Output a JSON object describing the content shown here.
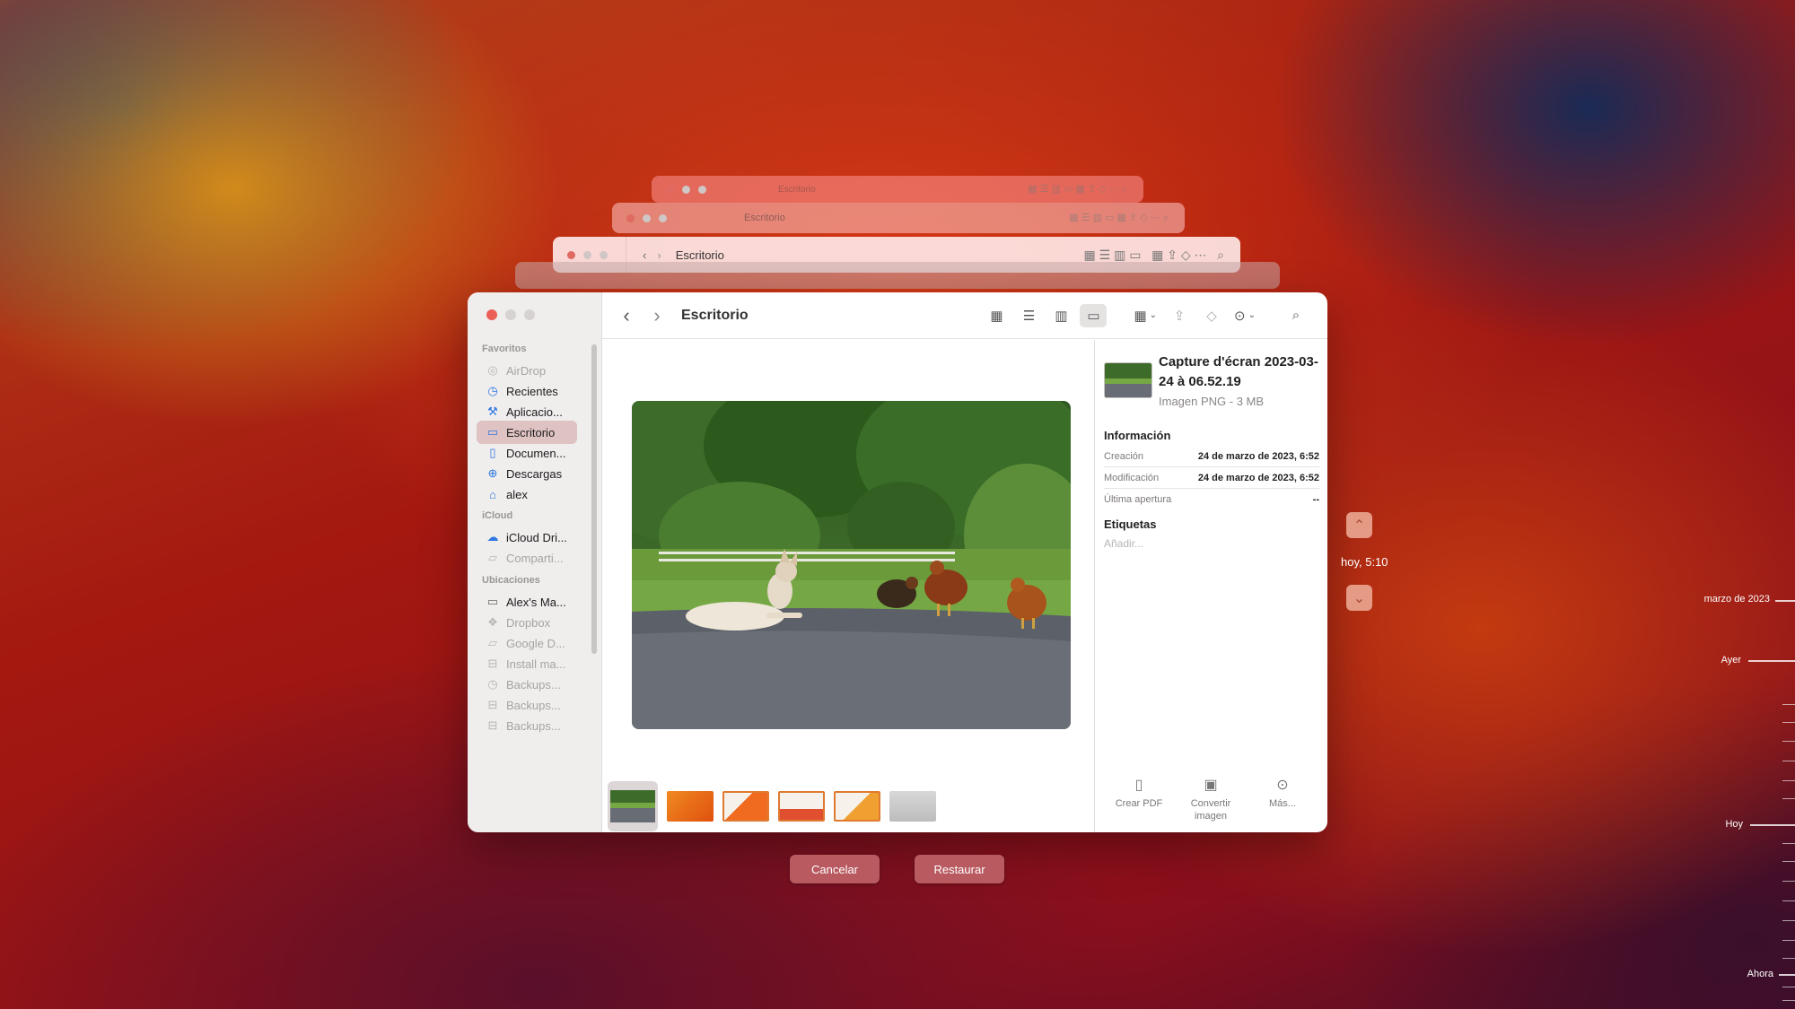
{
  "window": {
    "title": "Escritorio"
  },
  "ghost_windows": [
    {
      "title": "Escritorio"
    },
    {
      "title": "Escritorio"
    },
    {
      "title": "Escritorio"
    }
  ],
  "sidebar": {
    "sections": [
      {
        "label": "Favoritos"
      },
      {
        "label": "iCloud"
      },
      {
        "label": "Ubicaciones"
      }
    ],
    "items": [
      {
        "label": "AirDrop",
        "icon": "airdrop-icon"
      },
      {
        "label": "Recientes",
        "icon": "clock-icon"
      },
      {
        "label": "Aplicacio...",
        "icon": "applications-icon"
      },
      {
        "label": "Escritorio",
        "icon": "desktop-icon"
      },
      {
        "label": "Documen...",
        "icon": "document-icon"
      },
      {
        "label": "Descargas",
        "icon": "download-icon"
      },
      {
        "label": "alex",
        "icon": "home-icon"
      },
      {
        "label": "iCloud Dri...",
        "icon": "cloud-icon"
      },
      {
        "label": "Comparti...",
        "icon": "shared-folder-icon"
      },
      {
        "label": "Alex's Ma...",
        "icon": "computer-icon"
      },
      {
        "label": "Dropbox",
        "icon": "dropbox-icon"
      },
      {
        "label": "Google D...",
        "icon": "folder-icon"
      },
      {
        "label": "Install ma...",
        "icon": "drive-icon"
      },
      {
        "label": "Backups...",
        "icon": "time-machine-icon"
      },
      {
        "label": "Backups...",
        "icon": "drive-icon"
      },
      {
        "label": "Backups...",
        "icon": "drive-icon"
      }
    ]
  },
  "inspector": {
    "file_name": "Capture d'écran 2023-03-24 à 06.52.19",
    "file_kind": "Imagen PNG - 3 MB",
    "info_heading": "Información",
    "rows": [
      {
        "key": "Creación",
        "value": "24 de marzo de 2023, 6:52"
      },
      {
        "key": "Modificación",
        "value": "24 de marzo de 2023, 6:52"
      },
      {
        "key": "Última apertura",
        "value": "--"
      }
    ],
    "tags_heading": "Etiquetas",
    "tags_placeholder": "Añadir...",
    "actions": [
      {
        "label": "Crear PDF",
        "icon": "pdf-icon"
      },
      {
        "label": "Convertir imagen",
        "icon": "convert-image-icon"
      },
      {
        "label": "Más...",
        "icon": "more-icon"
      }
    ]
  },
  "buttons": {
    "cancel": "Cancelar",
    "restore": "Restaurar"
  },
  "timemachine": {
    "current_time": "hoy, 5:10",
    "timeline": [
      "marzo de 2023",
      "Ayer",
      "Hoy",
      "Ahora"
    ]
  }
}
